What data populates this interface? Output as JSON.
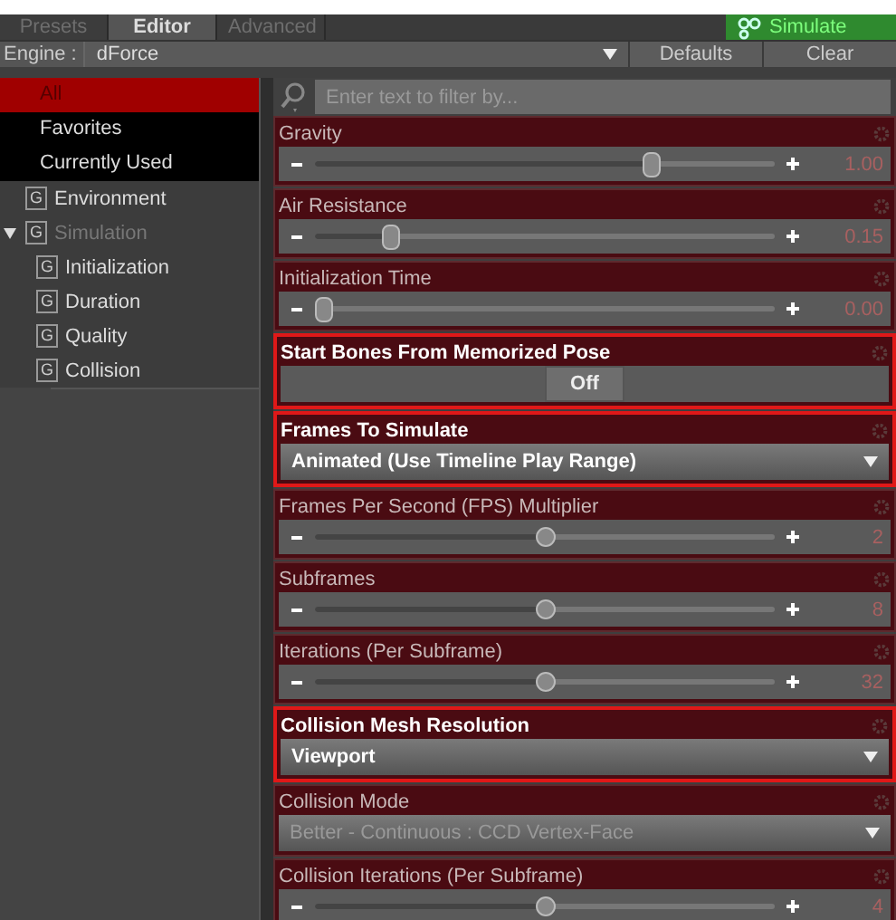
{
  "tabs": [
    {
      "label": "Presets",
      "selected": false
    },
    {
      "label": "Editor",
      "selected": true
    },
    {
      "label": "Advanced",
      "selected": false
    }
  ],
  "simulate_button": {
    "label": "Simulate"
  },
  "engine": {
    "label": "Engine :",
    "value": "dForce"
  },
  "buttons": [
    "Defaults",
    "Clear"
  ],
  "sidebar": {
    "items": [
      {
        "label": "All",
        "selected": true
      },
      {
        "label": "Favorites",
        "selected": false
      },
      {
        "label": "Currently Used",
        "selected": false
      }
    ],
    "tree": [
      {
        "label": "Environment",
        "badge": "G",
        "disabled": false,
        "expanded": false
      },
      {
        "label": "Simulation",
        "badge": "G",
        "disabled": true,
        "expanded": true,
        "children": [
          {
            "label": "Initialization",
            "badge": "G",
            "disabled": false
          },
          {
            "label": "Duration",
            "badge": "G",
            "disabled": false
          },
          {
            "label": "Quality",
            "badge": "G",
            "disabled": false
          },
          {
            "label": "Collision",
            "badge": "G",
            "disabled": false
          }
        ]
      }
    ]
  },
  "filter": {
    "placeholder": "Enter text to filter by..."
  },
  "properties": [
    {
      "kind": "slider",
      "label": "Gravity",
      "level": 0.74,
      "reading": "1.00",
      "highlighted": false
    },
    {
      "kind": "slider",
      "label": "Air Resistance",
      "level": 0.15,
      "reading": "0.15",
      "highlighted": false
    },
    {
      "kind": "slider",
      "label": "Initialization Time",
      "level": 0,
      "reading": "0.00",
      "highlighted": false
    },
    {
      "kind": "toggle",
      "label": "Start Bones From Memorized Pose",
      "value": "Off",
      "highlighted": true
    },
    {
      "kind": "dropdown",
      "label": "Frames To Simulate",
      "value": "Animated (Use Timeline Play Range)",
      "highlighted": true
    },
    {
      "kind": "slider",
      "label": "Frames Per Second (FPS) Multiplier",
      "level": 0.5,
      "reading": "2",
      "highlighted": false
    },
    {
      "kind": "slider",
      "label": "Subframes",
      "level": 0.5,
      "reading": "8",
      "highlighted": false
    },
    {
      "kind": "slider",
      "label": "Iterations (Per Subframe)",
      "level": 0.5,
      "reading": "32",
      "highlighted": false
    },
    {
      "kind": "dropdown",
      "label": "Collision Mesh Resolution",
      "value": "Viewport",
      "highlighted": true
    },
    {
      "kind": "dropdown",
      "label": "Collision Mode",
      "value": "Better - Continuous : CCD Vertex-Face",
      "highlighted": false
    },
    {
      "kind": "slider",
      "label": "Collision Iterations (Per Subframe)",
      "level": 0.5,
      "reading": "4",
      "highlighted": false
    }
  ]
}
